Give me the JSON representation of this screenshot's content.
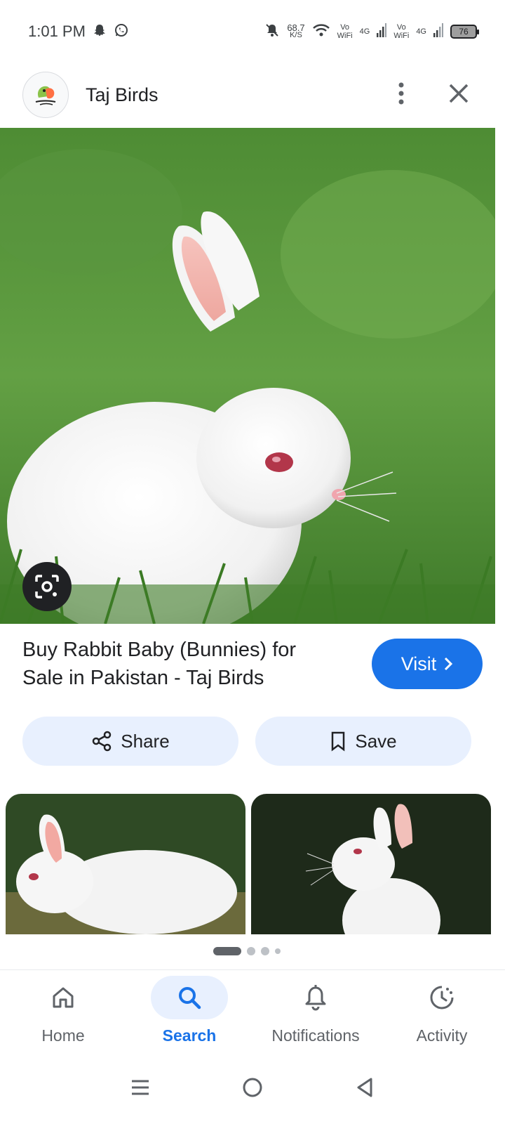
{
  "status_bar": {
    "time": "1:01 PM",
    "net_speed": "68.7",
    "net_unit": "K/S",
    "sim1_label": "Vo\nWiFi",
    "sim1_net": "4G",
    "sim2_label": "Vo\nWiFi",
    "sim2_net": "4G",
    "battery": "76"
  },
  "header": {
    "site_name": "Taj Birds"
  },
  "result": {
    "title": "Buy Rabbit Baby (Bunnies) for Sale in Pakistan - Taj Birds",
    "visit_label": "Visit"
  },
  "actions": {
    "share_label": "Share",
    "save_label": "Save"
  },
  "bottom_nav": {
    "items": [
      {
        "label": "Home",
        "icon": "home-icon",
        "active": false
      },
      {
        "label": "Search",
        "icon": "search-icon",
        "active": true
      },
      {
        "label": "Notifications",
        "icon": "bell-icon",
        "active": false
      },
      {
        "label": "Activity",
        "icon": "activity-icon",
        "active": false
      }
    ]
  },
  "colors": {
    "accent": "#1a73e8",
    "chip_bg": "#e8f0fe",
    "grass": "#4f8f3a"
  }
}
